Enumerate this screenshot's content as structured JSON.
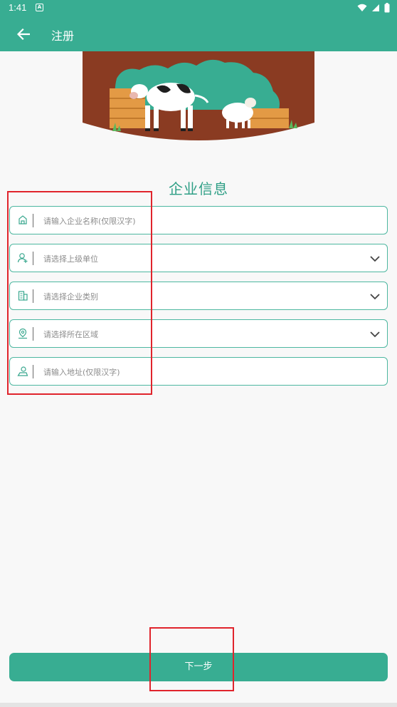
{
  "status_bar": {
    "time": "1:41",
    "notification_glyph": "A",
    "icons": [
      "wifi-icon",
      "signal-icon",
      "battery-icon"
    ]
  },
  "app_bar": {
    "title": "注册",
    "back_icon": "arrow-left-icon"
  },
  "banner": {
    "icon": "farm-cow-sheep-illustration"
  },
  "form": {
    "title": "企业信息",
    "fields": [
      {
        "placeholder": "请输入企业名称(仅限汉字)",
        "icon": "company-icon",
        "type": "input"
      },
      {
        "placeholder": "请选择上级单位",
        "icon": "user-icon",
        "type": "select"
      },
      {
        "placeholder": "请选择企业类别",
        "icon": "building-icon",
        "type": "select"
      },
      {
        "placeholder": "请选择所在区域",
        "icon": "location-icon",
        "type": "select"
      },
      {
        "placeholder": "请输入地址(仅限汉字)",
        "icon": "address-icon",
        "type": "input"
      }
    ]
  },
  "next_button": {
    "label": "下一步"
  },
  "colors": {
    "primary": "#38ad92",
    "field_border": "#4db7a0",
    "highlight": "#e0242c"
  }
}
